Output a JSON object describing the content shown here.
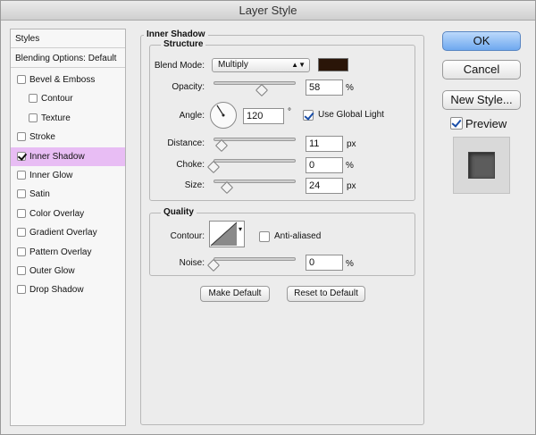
{
  "window": {
    "title": "Layer Style"
  },
  "styles_list": {
    "header": "Styles",
    "blending_options": "Blending Options: Default",
    "items": [
      {
        "label": "Bevel & Emboss",
        "checked": false,
        "indent": false
      },
      {
        "label": "Contour",
        "checked": false,
        "indent": true
      },
      {
        "label": "Texture",
        "checked": false,
        "indent": true
      },
      {
        "label": "Stroke",
        "checked": false,
        "indent": false
      },
      {
        "label": "Inner Shadow",
        "checked": true,
        "indent": false,
        "selected": true
      },
      {
        "label": "Inner Glow",
        "checked": false,
        "indent": false
      },
      {
        "label": "Satin",
        "checked": false,
        "indent": false
      },
      {
        "label": "Color Overlay",
        "checked": false,
        "indent": false
      },
      {
        "label": "Gradient Overlay",
        "checked": false,
        "indent": false
      },
      {
        "label": "Pattern Overlay",
        "checked": false,
        "indent": false
      },
      {
        "label": "Outer Glow",
        "checked": false,
        "indent": false
      },
      {
        "label": "Drop Shadow",
        "checked": false,
        "indent": false
      }
    ]
  },
  "inner_shadow": {
    "title": "Inner Shadow",
    "structure": {
      "title": "Structure",
      "blend_mode_label": "Blend Mode:",
      "blend_mode_value": "Multiply",
      "shadow_color": "#2a1508",
      "opacity_label": "Opacity:",
      "opacity_value": "58",
      "opacity_unit": "%",
      "angle_label": "Angle:",
      "angle_value": "120",
      "angle_unit": "°",
      "use_global_light_label": "Use Global Light",
      "use_global_light": true,
      "distance_label": "Distance:",
      "distance_value": "11",
      "distance_unit": "px",
      "choke_label": "Choke:",
      "choke_value": "0",
      "choke_unit": "%",
      "size_label": "Size:",
      "size_value": "24",
      "size_unit": "px"
    },
    "quality": {
      "title": "Quality",
      "contour_label": "Contour:",
      "anti_aliased_label": "Anti-aliased",
      "anti_aliased": false,
      "noise_label": "Noise:",
      "noise_value": "0",
      "noise_unit": "%"
    },
    "make_default_label": "Make Default",
    "reset_default_label": "Reset to Default"
  },
  "buttons": {
    "ok": "OK",
    "cancel": "Cancel",
    "new_style": "New Style...",
    "preview_label": "Preview",
    "preview_checked": true
  },
  "colors": {
    "selected_item": "#e8bdf4",
    "ok_button": "#6ea8ef"
  }
}
